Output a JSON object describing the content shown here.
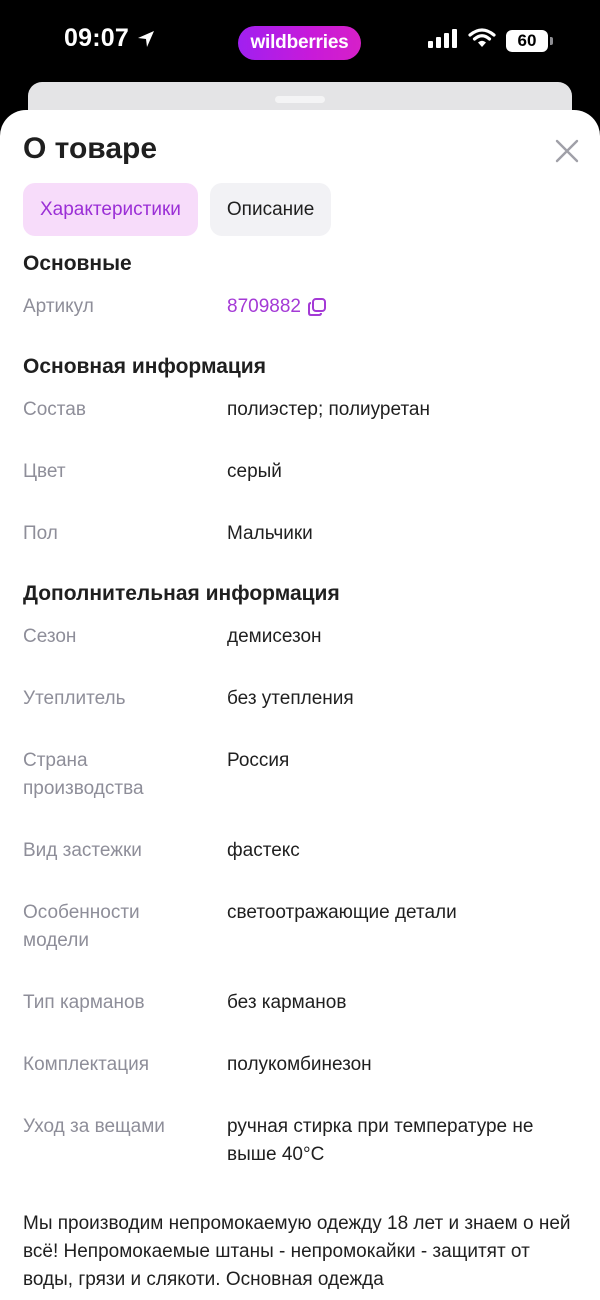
{
  "status_bar": {
    "time": "09:07",
    "brand": "wildberries",
    "battery": "60"
  },
  "sheet": {
    "title": "О товаре",
    "tabs": [
      {
        "label": "Характеристики",
        "active": true
      },
      {
        "label": "Описание",
        "active": false
      }
    ]
  },
  "sections": {
    "basic": {
      "title": "Основные",
      "article_label": "Артикул",
      "article_value": "8709882"
    },
    "main_info": {
      "title": "Основная информация",
      "rows": [
        {
          "label": "Состав",
          "value": "полиэстер; полиуретан"
        },
        {
          "label": "Цвет",
          "value": "серый"
        },
        {
          "label": "Пол",
          "value": "Мальчики"
        }
      ]
    },
    "extra_info": {
      "title": "Дополнительная информация",
      "rows": [
        {
          "label": "Сезон",
          "value": "демисезон"
        },
        {
          "label": "Утеплитель",
          "value": "без утепления"
        },
        {
          "label": "Страна производства",
          "value": "Россия"
        },
        {
          "label": "Вид застежки",
          "value": "фастекс"
        },
        {
          "label": "Особенности модели",
          "value": "светоотражающие детали"
        },
        {
          "label": "Тип карманов",
          "value": "без карманов"
        },
        {
          "label": "Комплектация",
          "value": "полукомбинезон"
        },
        {
          "label": "Уход за вещами",
          "value": "ручная стирка при температуре не выше 40°C"
        }
      ]
    }
  },
  "description": "Мы производим непромокаемую одежду 18 лет и знаем о ней всё! Непромокаемые штаны - непромокайки - защитят от воды, грязи и слякоти. Основная одежда",
  "colors": {
    "accent": "#a43ad6",
    "tab_active_bg": "#f7dcfa",
    "label_gray": "#8e8e99"
  }
}
